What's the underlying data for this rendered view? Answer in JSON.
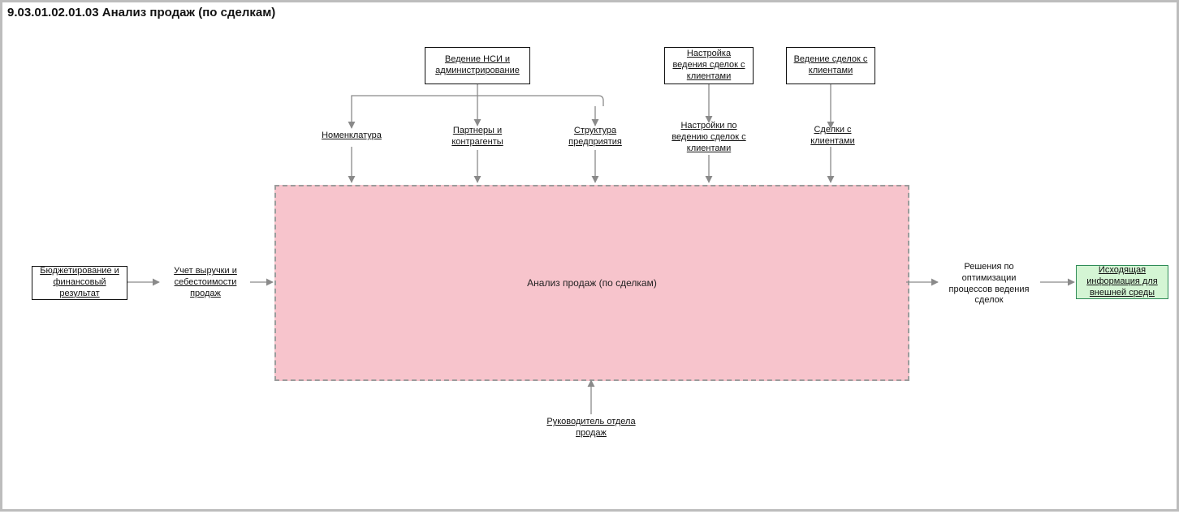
{
  "title": "9.03.01.02.01.03 Анализ продаж (по сделкам)",
  "top_sources": {
    "nsi": "Ведение НСИ и администрирование",
    "deal_setup": "Настройка ведения сделок с клиентами",
    "deal_mgmt": "Ведение сделок с клиентами"
  },
  "top_inputs": {
    "nomenclature": "Номенклатура",
    "partners": "Партнеры и контрагенты",
    "structure": "Структура предприятия",
    "deal_settings": "Настройки по ведению сделок с клиентами",
    "client_deals": "Сделки с клиентами"
  },
  "left": {
    "budget": "Бюджетирование и финансовый результат",
    "revenue": "Учет выручки и себестоимости продаж"
  },
  "center": "Анализ продаж (по сделкам)",
  "right": {
    "decisions": "Решения по оптимизации процессов ведения сделок",
    "outgoing": "Исходящая информация для внешней среды"
  },
  "bottom": {
    "manager": "Руководитель отдела продаж"
  }
}
